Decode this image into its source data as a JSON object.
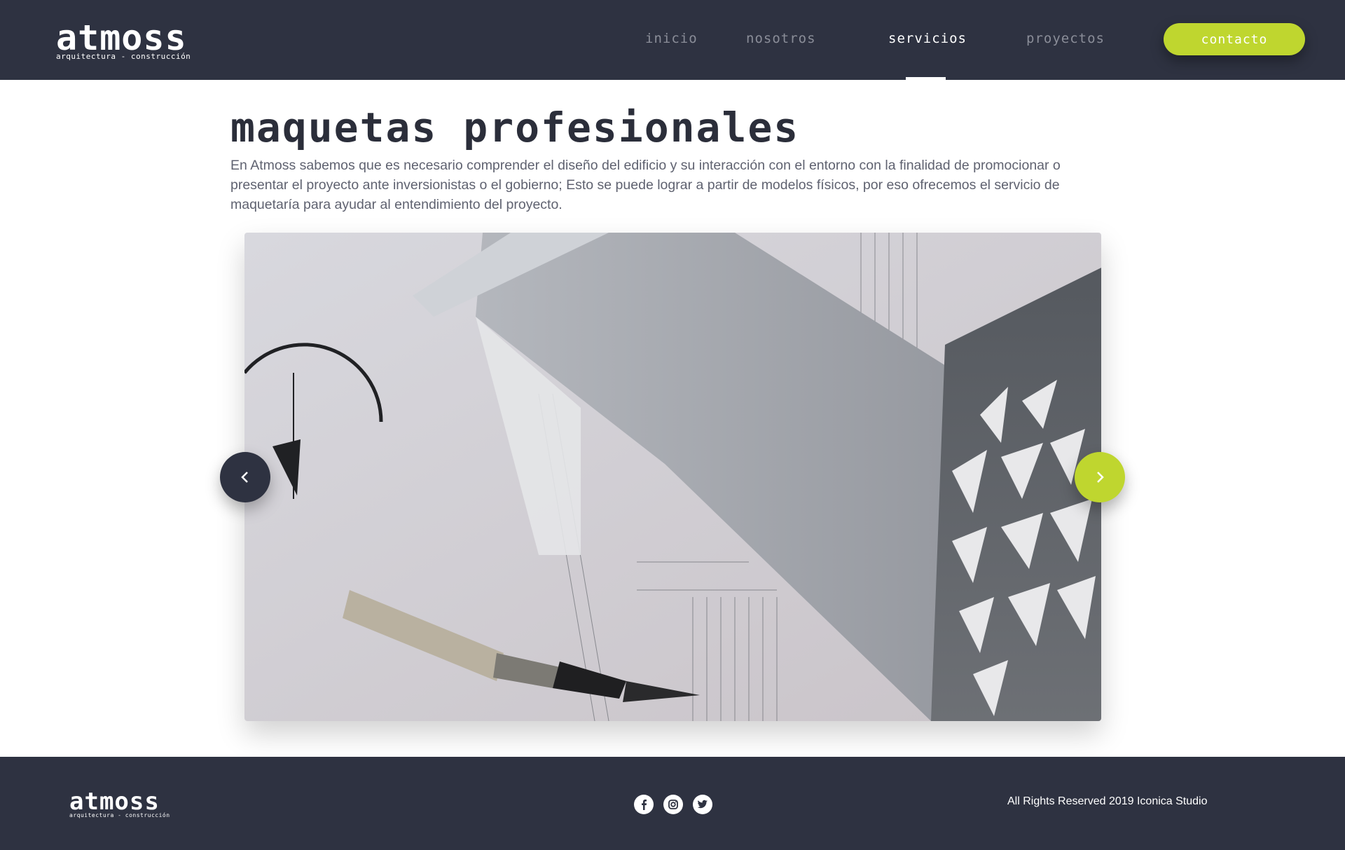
{
  "header": {
    "logo_text": "atmoss",
    "logo_tagline": "arquitectura - construcción",
    "nav": [
      {
        "label": "inicio"
      },
      {
        "label": "nosotros"
      },
      {
        "label": "servicios"
      },
      {
        "label": "proyectos"
      }
    ],
    "active_nav": "servicios",
    "contact_label": "contacto"
  },
  "main": {
    "title": "maquetas profesionales",
    "description": "En Atmoss sabemos que es necesario comprender el diseño del edificio y su interacción con el entorno con la finalidad de promocionar o presentar el proyecto ante inversionistas o el gobierno; Esto se puede lograr a partir de modelos físicos, por eso ofrecemos el servicio de maquetaría para ayudar al entendimiento del proyecto.",
    "slider": {
      "prev_icon": "chevron-left-icon",
      "next_icon": "chevron-right-icon"
    }
  },
  "footer": {
    "logo_text": "atmoss",
    "logo_tagline": "arquitectura - construcción",
    "social": [
      "facebook-icon",
      "instagram-icon",
      "twitter-icon"
    ],
    "copyright": "All Rights Reserved 2019 Iconica Studio"
  },
  "colors": {
    "header_bg": "#2e3241",
    "accent": "#bfd62f",
    "title": "#2b2e3a",
    "body_text": "#5f6270"
  }
}
